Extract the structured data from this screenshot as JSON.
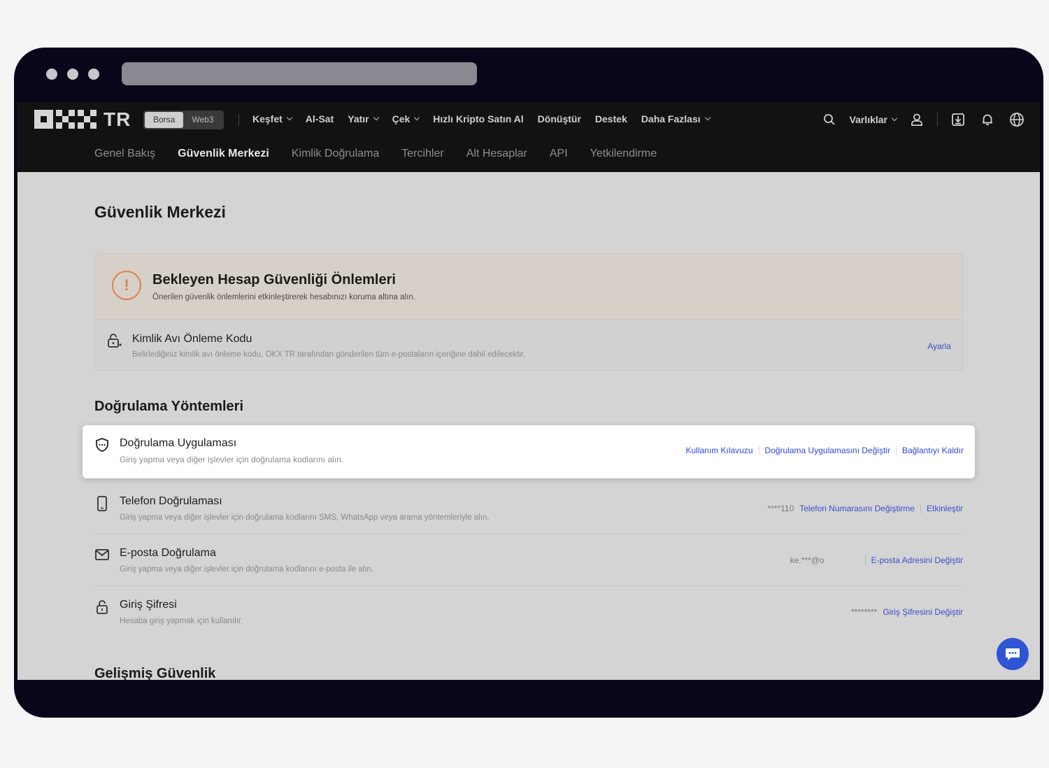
{
  "brand": {
    "logo_text": "TR"
  },
  "mode_switch": {
    "options": [
      "Borsa",
      "Web3"
    ],
    "active": "Borsa"
  },
  "top_menu": [
    {
      "label": "Keşfet",
      "dropdown": true
    },
    {
      "label": "Al-Sat",
      "dropdown": false
    },
    {
      "label": "Yatır",
      "dropdown": true
    },
    {
      "label": "Çek",
      "dropdown": true
    },
    {
      "label": "Hızlı Kripto Satın Al",
      "dropdown": false
    },
    {
      "label": "Dönüştür",
      "dropdown": false
    },
    {
      "label": "Destek",
      "dropdown": false
    },
    {
      "label": "Daha Fazlası",
      "dropdown": true
    }
  ],
  "right_nav": {
    "assets_label": "Varlıklar"
  },
  "sub_nav": {
    "items": [
      "Genel Bakış",
      "Güvenlik Merkezi",
      "Kimlik Doğrulama",
      "Tercihler",
      "Alt Hesaplar",
      "API",
      "Yetkilendirme"
    ],
    "active": "Güvenlik Merkezi"
  },
  "page": {
    "title": "Güvenlik Merkezi"
  },
  "pending_card": {
    "title": "Bekleyen Hesap Güvenliği Önlemleri",
    "subtitle": "Önerilen güvenlik önlemlerini etkinleştirerek hesabınızı koruma altına alın.",
    "row": {
      "title": "Kimlik Avı Önleme Kodu",
      "subtitle": "Belirlediğiniz kimlik avı önleme kodu, OKX TR tarafından gönderilen tüm e-postaların içeriğine dahil edilecektir.",
      "action": "Ayarla"
    }
  },
  "verification": {
    "section_title": "Doğrulama Yöntemleri",
    "authenticator": {
      "title": "Doğrulama Uygulaması",
      "subtitle": "Giriş yapma veya diğer işlevler için doğrulama kodlarını alın.",
      "actions": [
        "Kullanım Kılavuzu",
        "Doğrulama Uygulamasını Değiştir",
        "Bağlantıyı Kaldır"
      ]
    },
    "phone": {
      "title": "Telefon Doğrulaması",
      "subtitle": "Giriş yapma veya diğer işlevler için doğrulama kodlarını SMS, WhatsApp veya arama yöntemleriyle alın.",
      "value": "****110",
      "actions": [
        "Telefon Numarasını Değiştirme",
        "Etkinleştir"
      ]
    },
    "email": {
      "title": "E-posta Doğrulama",
      "subtitle": "Giriş yapma veya diğer işlevler için doğrulama kodlarını e-posta ile alın.",
      "value": "ke.***@o",
      "actions": [
        "E-posta Adresini Değiştir"
      ]
    },
    "password": {
      "title": "Giriş Şifresi",
      "subtitle": "Hesaba giriş yapmak için kullanılır.",
      "value": "********",
      "actions": [
        "Giriş Şifresini Değiştir"
      ]
    }
  },
  "advanced": {
    "section_title": "Gelişmiş Güvenlik"
  },
  "colors": {
    "link": "#2f4ad6",
    "warning": "#d9844e",
    "chat": "#2f55d4"
  }
}
